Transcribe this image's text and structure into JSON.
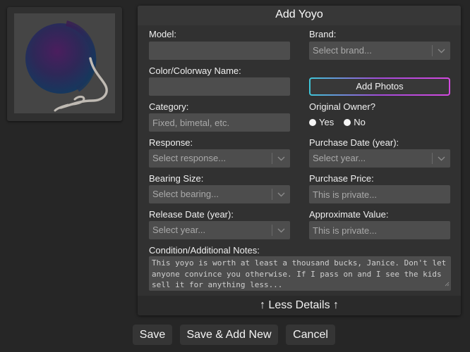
{
  "header": {
    "title": "Add Yoyo"
  },
  "fields": {
    "model": {
      "label": "Model:",
      "value": ""
    },
    "brand": {
      "label": "Brand:",
      "placeholder": "Select brand..."
    },
    "color": {
      "label": "Color/Colorway Name:",
      "value": ""
    },
    "category": {
      "label": "Category:",
      "placeholder": "Fixed, bimetal, etc."
    },
    "original_owner": {
      "label": "Original Owner?",
      "options": [
        "Yes",
        "No"
      ]
    },
    "response": {
      "label": "Response:",
      "placeholder": "Select response..."
    },
    "purchase_date": {
      "label": "Purchase Date (year):",
      "placeholder": "Select year..."
    },
    "bearing": {
      "label": "Bearing Size:",
      "placeholder": "Select bearing..."
    },
    "purchase_price": {
      "label": "Purchase Price:",
      "placeholder": "This is private..."
    },
    "release_date": {
      "label": "Release Date (year):",
      "placeholder": "Select year..."
    },
    "approx_value": {
      "label": "Approximate Value:",
      "placeholder": "This is private..."
    },
    "notes": {
      "label": "Condition/Additional Notes:",
      "value": "This yoyo is worth at least a thousand bucks, Janice. Don't let anyone convince you otherwise. If I pass on and I see the kids sell it for anything less..."
    }
  },
  "buttons": {
    "add_photos": "Add Photos",
    "less_details": "↑  Less Details  ↑",
    "save": "Save",
    "save_add_new": "Save & Add New",
    "cancel": "Cancel"
  },
  "icons": {
    "yoyo": "yoyo-image",
    "chevron": "chevron-down-icon"
  },
  "colors": {
    "background": "#262626",
    "panel": "#313131",
    "field": "#4d4d4d",
    "gradient_start": "#3ec6d8",
    "gradient_end": "#d44ae0"
  }
}
